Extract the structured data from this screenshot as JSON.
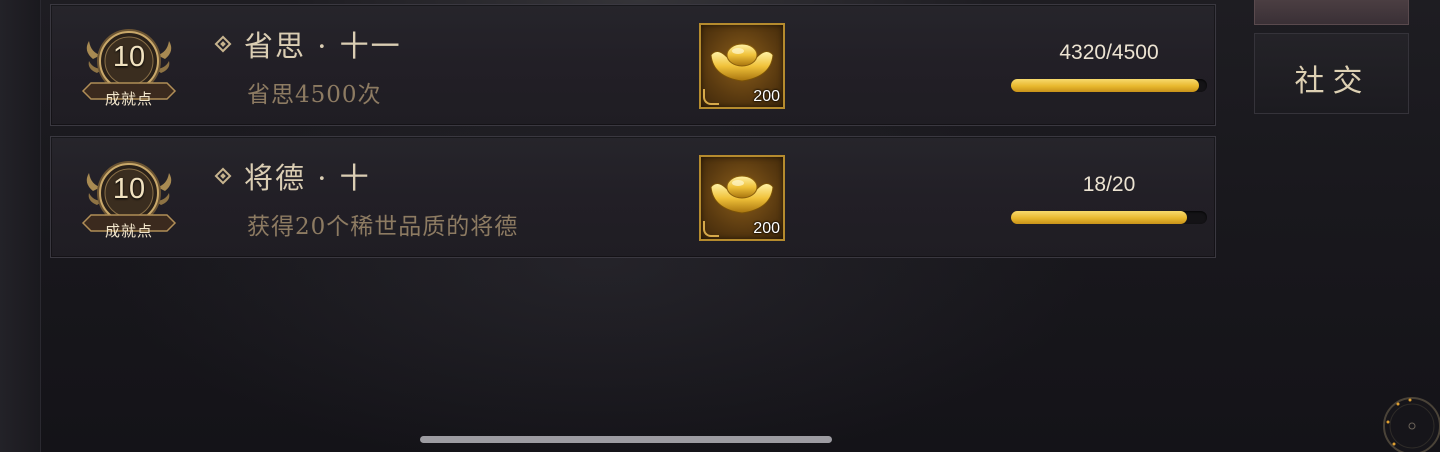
{
  "achievements": [
    {
      "points": "10",
      "points_label": "成就点",
      "title": "省思 · 十一",
      "description": "省思4500次",
      "reward_count": "200",
      "reward_icon": "gold-ingot-icon",
      "progress_text": "4320/4500",
      "progress_fraction": 0.96
    },
    {
      "points": "10",
      "points_label": "成就点",
      "title": "将德 · 十",
      "description": "获得20个稀世品质的将德",
      "reward_count": "200",
      "reward_icon": "gold-ingot-icon",
      "progress_text": "18/20",
      "progress_fraction": 0.9
    }
  ],
  "side_tabs": {
    "social_label": "社交"
  },
  "colors": {
    "gold_accent": "#e8b82e",
    "title_text": "#dacdb3",
    "desc_text": "#8d7b62",
    "background": "#19181d"
  }
}
